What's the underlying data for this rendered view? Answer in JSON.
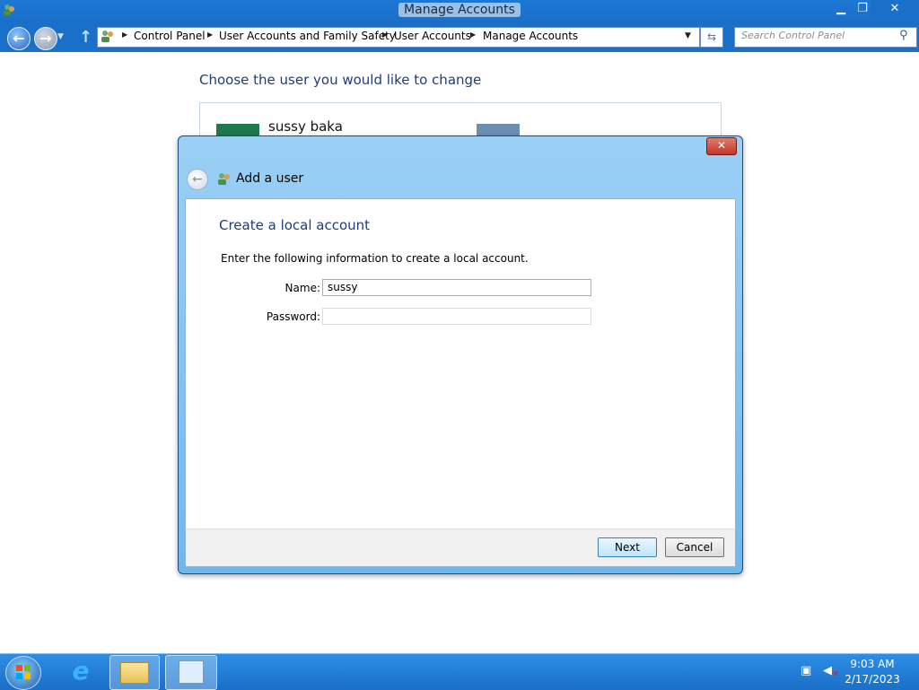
{
  "window": {
    "title": "Manage Accounts"
  },
  "address_bar": {
    "crumbs": [
      "Control Panel",
      "User Accounts and Family Safety",
      "User Accounts",
      "Manage Accounts"
    ]
  },
  "search": {
    "placeholder": "Search Control Panel"
  },
  "page": {
    "heading": "Choose the user you would like to change",
    "users": [
      {
        "name": "sussy baka"
      }
    ]
  },
  "dialog": {
    "title": "Add a user",
    "heading": "Create a local account",
    "instruction": "Enter the following information to create a local account.",
    "name_label": "Name:",
    "name_value": "sussy",
    "password_label": "Password:",
    "password_value": "",
    "next_label": "Next",
    "cancel_label": "Cancel"
  },
  "taskbar": {
    "clock_time": "9:03 AM",
    "clock_date": "2/17/2023"
  },
  "colors": {
    "accent": "#1a6fc8",
    "link_blue": "#1e3d7a",
    "dialog_glass": "#9bd0f5"
  },
  "icons": [
    "users-icon",
    "back-arrow-icon",
    "forward-arrow-icon",
    "up-arrow-icon",
    "refresh-icon",
    "search-icon",
    "close-icon",
    "minimize-icon",
    "maximize-icon",
    "start-orb-icon",
    "internet-explorer-icon",
    "folder-icon",
    "control-panel-icon",
    "network-icon",
    "volume-muted-icon"
  ]
}
